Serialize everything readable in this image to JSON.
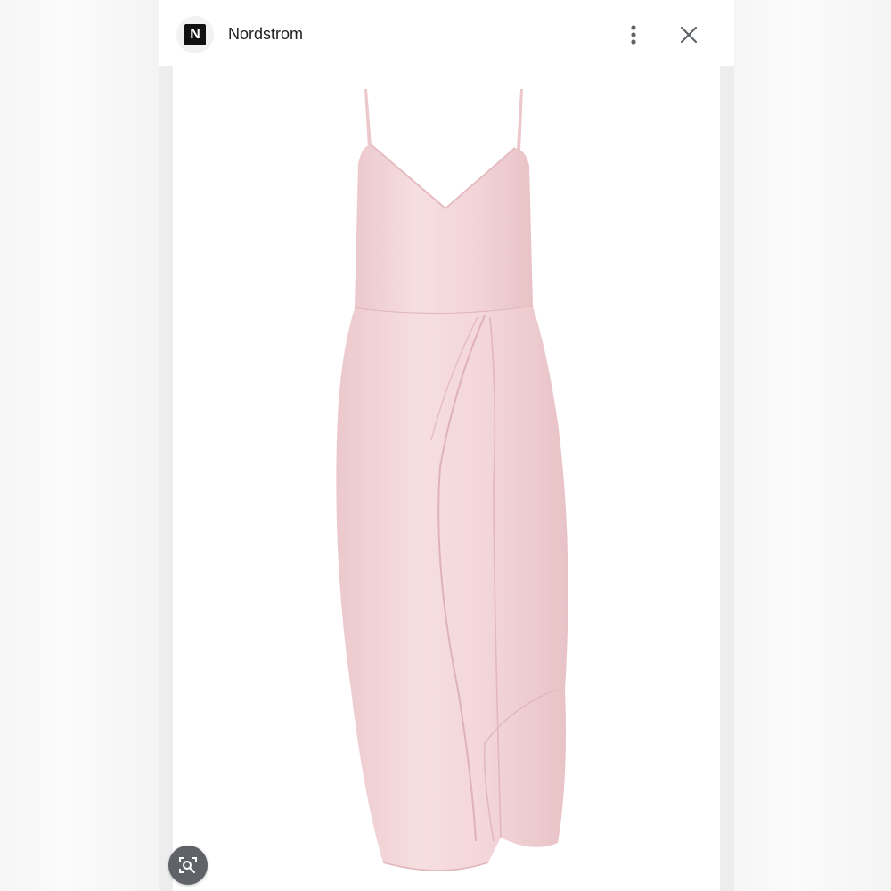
{
  "header": {
    "site_name": "Nordstrom",
    "logo_letter": "N"
  },
  "icons": {
    "menu": "more-vert-icon",
    "close": "close-icon",
    "lens": "visual-search-icon"
  },
  "colors": {
    "dress": "#f4d9db",
    "text": "#202124",
    "lens_button": "#5f6368"
  }
}
